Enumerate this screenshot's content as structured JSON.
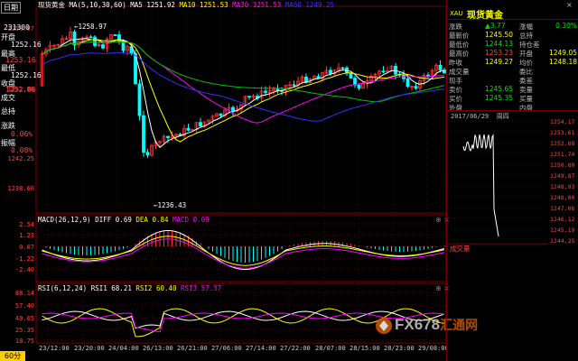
{
  "main_header": {
    "instrument": "现货黄金",
    "ma_params": "MA(5,10,30,60)",
    "ma5_label": "MA5",
    "ma5_value": "1251.92",
    "ma10_label": "MA10",
    "ma10_value": "1251.53",
    "ma30_label": "MA30",
    "ma30_value": "1251.53",
    "ma60_label": "MA60",
    "ma60_value": "1249.25"
  },
  "left_col": {
    "title": "日期",
    "date_value": "231300",
    "open_label": "开盘",
    "open_value": "1252.16",
    "high_label": "最高",
    "high_value": "1253.16",
    "low_label": "最低",
    "low_value": "1252.16",
    "close_label": "收盘",
    "close_value": "1252.86",
    "volume_label": "成交",
    "hold_label": "总持",
    "change_label": "涨跌",
    "change_value": "0.06%",
    "amp_label": "振幅",
    "amp_value": "0.08%"
  },
  "price_axis": [
    "1258.97",
    "1252.86",
    "1242.25",
    "1238.60"
  ],
  "annotations": {
    "high_mark": "1258.97",
    "low_mark": "1236.43"
  },
  "macd": {
    "header": "MACD(26,12,9)",
    "diff_label": "DIFF",
    "diff_value": "0.69",
    "dea_label": "DEA",
    "dea_value": "0.84",
    "macd_label": "MACD",
    "macd_value": "0.09",
    "axis": [
      "2.54",
      "1.23",
      "0.07",
      "-1.22",
      "-2.40"
    ]
  },
  "rsi": {
    "header": "RSI(6,12,24)",
    "rsi1_label": "RSI1",
    "rsi1_value": "68.21",
    "rsi2_label": "RSI2",
    "rsi2_value": "60.40",
    "rsi3_label": "RSI3",
    "rsi3_value": "57.37",
    "axis": [
      "88.14",
      "57.40",
      "40.65",
      "25.35",
      "18.75"
    ]
  },
  "x_axis": [
    "23/12:00",
    "23/20:00",
    "24/04:00",
    "26/13:00",
    "26/21:00",
    "27/06:00",
    "27/14:00",
    "27/22:00",
    "28/07:00",
    "28/15:00",
    "28/23:00",
    "29/08:00"
  ],
  "period_button": "60分",
  "watermark": "FX678",
  "watermark_cn": "汇通网",
  "right_panel": {
    "symbol": "XAU",
    "name": "现货黄金",
    "rows": [
      {
        "l": "涨跌",
        "v": "▲3.77",
        "l2": "涨幅",
        "v2": "0.30%"
      },
      {
        "l": "最新价",
        "v": "1245.50",
        "l2": "总持",
        "v2": ""
      },
      {
        "l": "最低价",
        "v": "1244.13",
        "l2": "持仓差",
        "v2": ""
      },
      {
        "l": "最高价",
        "v": "1253.23",
        "l2": "开盘",
        "v2": "1249.05"
      },
      {
        "l": "昨收",
        "v": "1249.27",
        "l2": "均价",
        "v2": "1248.18"
      },
      {
        "l": "成交量",
        "v": "",
        "l2": "委比",
        "v2": ""
      },
      {
        "l": "现手",
        "v": "",
        "l2": "委差",
        "v2": ""
      },
      {
        "l": "卖价",
        "v": "1245.65",
        "l2": "卖量",
        "v2": ""
      },
      {
        "l": "买价",
        "v": "1245.35",
        "l2": "买量",
        "v2": ""
      },
      {
        "l": "外盘",
        "v": "",
        "l2": "内盘",
        "v2": ""
      }
    ],
    "timestamp": "2017/06/29",
    "weekday": "周四",
    "mini_axis": [
      "1254.17",
      "1253.61",
      "1252.68",
      "1251.74",
      "1250.80",
      "1249.87",
      "1248.93",
      "1248.00",
      "1247.06",
      "1246.12",
      "1245.19",
      "1244.25"
    ],
    "volume_label": "成交量"
  },
  "colors": {
    "up": "#ff3030",
    "down": "#00ffff",
    "ma5": "#ffffff",
    "ma10": "#ffff00",
    "ma30": "#ff00ff",
    "ma60": "#00ff00",
    "grid": "#7a0000"
  }
}
